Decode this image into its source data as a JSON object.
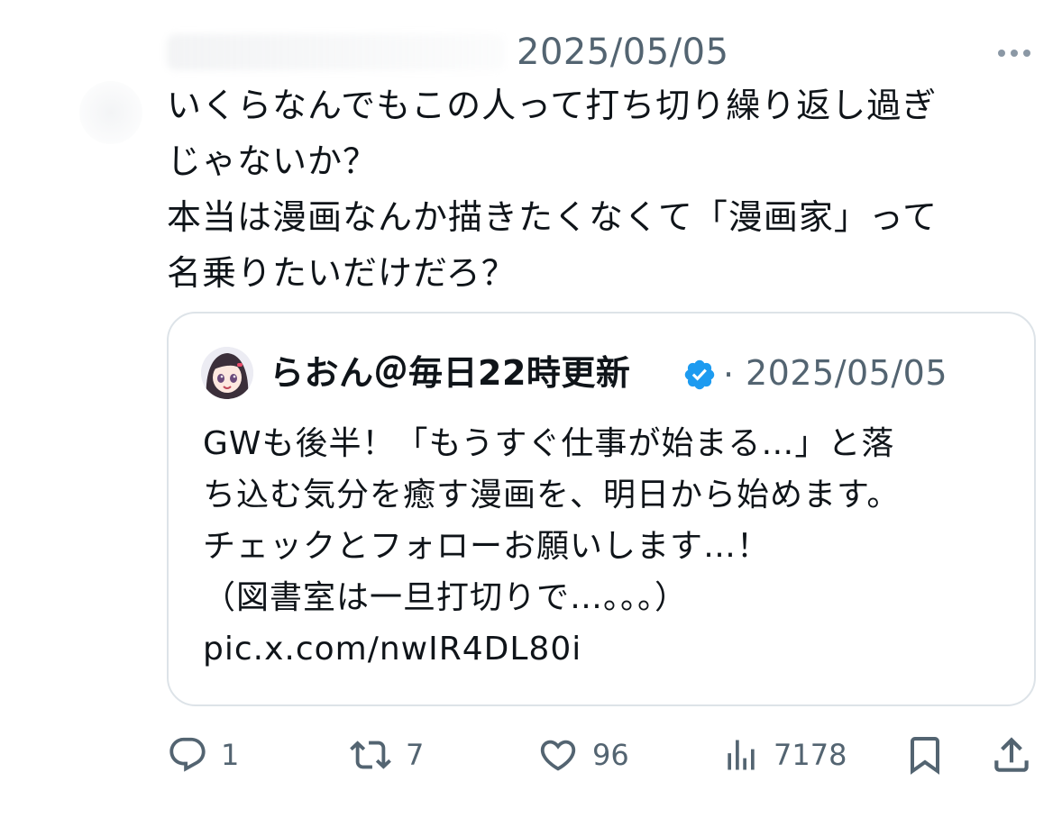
{
  "tweet": {
    "date": "2025/05/05",
    "text": "いくらなんでもこの人って打ち切り繰り返し過ぎ\nじゃないか？\n本当は漫画なんか描きたくなくて「漫画家」って\n名乗りたいだけだろ？"
  },
  "quote": {
    "display_name": "らおん＠毎日22時更新",
    "separator": "·",
    "date": "2025/05/05",
    "text": "GWも後半！「もうすぐ仕事が始まる…」と落\nち込む気分を癒す漫画を、明日から始めます。\nチェックとフォローお願いします…！\n（図書室は一旦打切りで…。。。）\npic.x.com/nwIR4DL80i",
    "verified_color": "#1d9bf0"
  },
  "actions": {
    "reply_count": "1",
    "retweet_count": "7",
    "like_count": "96",
    "views_count": "7178"
  },
  "icons": {
    "more": "more-horizontal-icon",
    "reply": "reply-icon",
    "retweet": "retweet-icon",
    "like": "heart-icon",
    "views": "views-chart-icon",
    "bookmark": "bookmark-icon",
    "share": "share-icon",
    "verified": "verified-badge-icon"
  }
}
